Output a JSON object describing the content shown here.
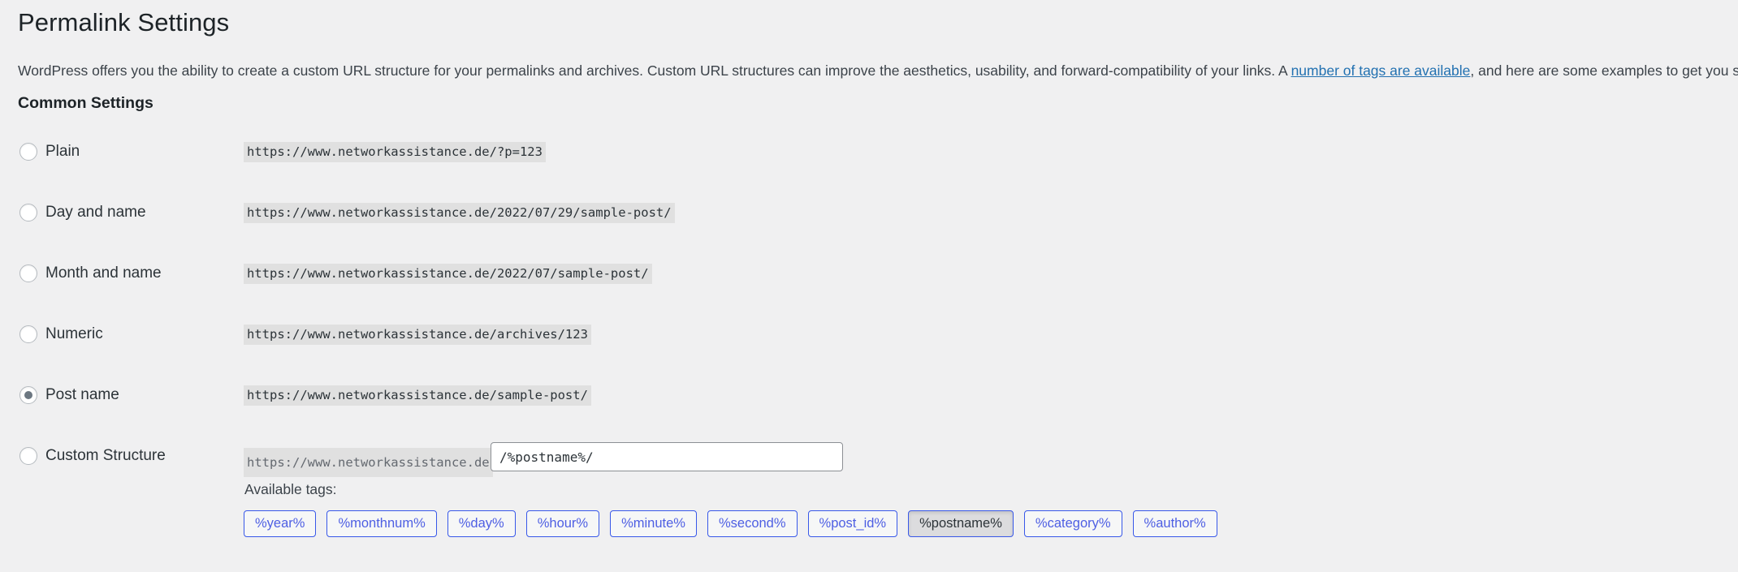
{
  "header": {
    "title": "Permalink Settings",
    "description_before_link": "WordPress offers you the ability to create a custom URL structure for your permalinks and archives. Custom URL structures can improve the aesthetics, usability, and forward-compatibility of your links. A ",
    "link_text": "number of tags are available",
    "description_after_link": ", and here are some examples to get you started.",
    "link_color": "#2271b1"
  },
  "common_settings": {
    "section_title": "Common Settings",
    "options": [
      {
        "label": "Plain",
        "example": "https://www.networkassistance.de/?p=123",
        "selected": false
      },
      {
        "label": "Day and name",
        "example": "https://www.networkassistance.de/2022/07/29/sample-post/",
        "selected": false
      },
      {
        "label": "Month and name",
        "example": "https://www.networkassistance.de/2022/07/sample-post/",
        "selected": false
      },
      {
        "label": "Numeric",
        "example": "https://www.networkassistance.de/archives/123",
        "selected": false
      },
      {
        "label": "Post name",
        "example": "https://www.networkassistance.de/sample-post/",
        "selected": true
      }
    ],
    "custom_structure": {
      "label": "Custom Structure",
      "prefix": "https://www.networkassistance.de",
      "value": "/%postname%/",
      "placeholder": "",
      "selected": false,
      "available_tags_label": "Available tags:",
      "tags": [
        {
          "label": "%year%",
          "active": false
        },
        {
          "label": "%monthnum%",
          "active": false
        },
        {
          "label": "%day%",
          "active": false
        },
        {
          "label": "%hour%",
          "active": false
        },
        {
          "label": "%minute%",
          "active": false
        },
        {
          "label": "%second%",
          "active": false
        },
        {
          "label": "%post_id%",
          "active": false
        },
        {
          "label": "%postname%",
          "active": true
        },
        {
          "label": "%category%",
          "active": false
        },
        {
          "label": "%author%",
          "active": false
        }
      ]
    }
  },
  "colors": {
    "page_background": "#f0f0f1",
    "code_background": "#e0e0e0",
    "tag_border": "#3858e9",
    "tag_text": "#4e5fe3",
    "tag_active_background": "#dcdcde",
    "radio_dot": "#6c7781"
  }
}
